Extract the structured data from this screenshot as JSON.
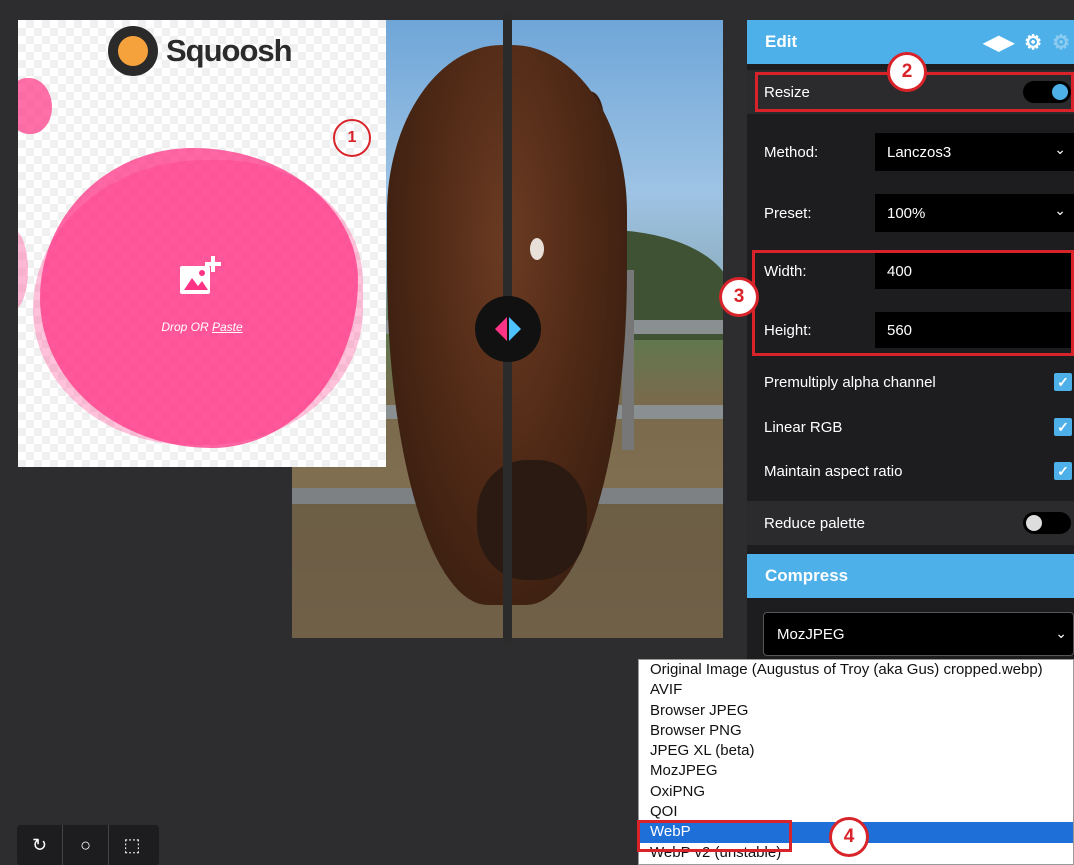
{
  "app": {
    "logo_text": "Squoosh",
    "drop_text_prefix": "Drop OR ",
    "drop_text_link": "Paste"
  },
  "edit": {
    "title": "Edit",
    "resize_label": "Resize",
    "resize_on": true,
    "method_label": "Method:",
    "method_value": "Lanczos3",
    "preset_label": "Preset:",
    "preset_value": "100%",
    "width_label": "Width:",
    "width_value": "400",
    "height_label": "Height:",
    "height_value": "560",
    "premultiply_label": "Premultiply alpha channel",
    "premultiply_checked": true,
    "linear_rgb_label": "Linear RGB",
    "linear_rgb_checked": true,
    "aspect_label": "Maintain aspect ratio",
    "aspect_checked": true,
    "reduce_palette_label": "Reduce palette",
    "reduce_palette_on": false
  },
  "compress": {
    "title": "Compress",
    "selected": "MozJPEG",
    "options": [
      "Original Image (Augustus of Troy (aka Gus) cropped.webp)",
      "AVIF",
      "Browser JPEG",
      "Browser PNG",
      "JPEG XL (beta)",
      "MozJPEG",
      "OxiPNG",
      "QOI",
      "WebP",
      "WebP v2 (unstable)"
    ],
    "highlighted": "WebP"
  },
  "annotations": {
    "marker_1": "1",
    "marker_2": "2",
    "marker_3": "3",
    "marker_4": "4"
  },
  "colors": {
    "accent_blue": "#4eb0e8",
    "brand_pink": "#ff3385",
    "callout_red": "#d9232a"
  },
  "icons": {
    "edit_header": [
      "split-arrows-icon",
      "gear-icon",
      "gear-dim-icon"
    ],
    "bottom_bar": [
      "rotate-icon",
      "circle-icon",
      "crop-icon"
    ],
    "drop": "add-image-icon"
  }
}
